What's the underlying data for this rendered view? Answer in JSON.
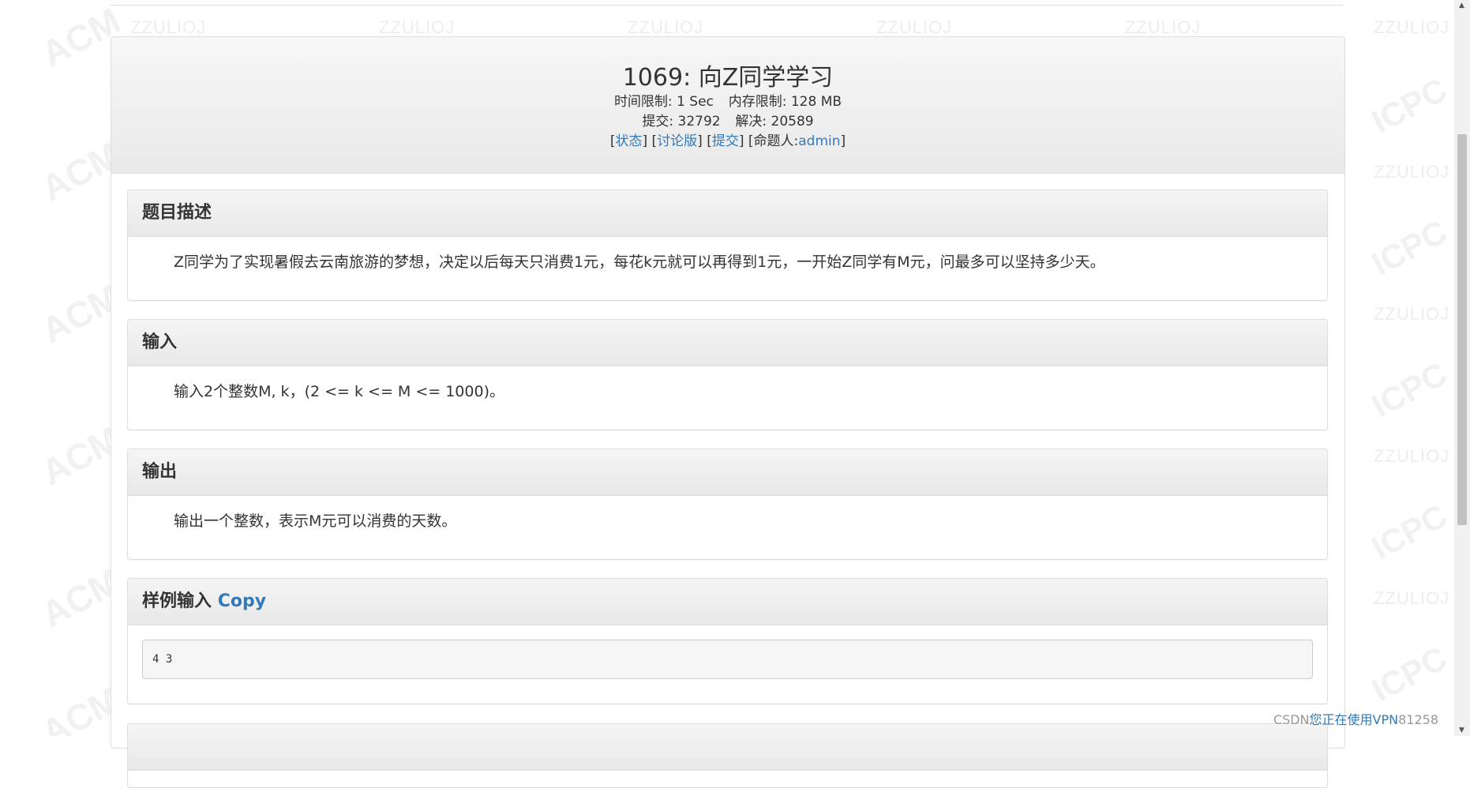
{
  "problem": {
    "title": "1069: 向Z同学学习",
    "time_limit_label": "时间限制:",
    "time_limit": "1 Sec",
    "memory_limit_label": "内存限制:",
    "memory_limit": "128 MB",
    "submit_label": "提交:",
    "submit_count": "32792",
    "solved_label": "解决:",
    "solved_count": "20589",
    "links": {
      "status": "状态",
      "discuss": "讨论版",
      "submit": "提交",
      "setter_label": "命题人:",
      "setter": "admin"
    }
  },
  "sections": {
    "description": {
      "title": "题目描述",
      "text": "Z同学为了实现暑假去云南旅游的梦想，决定以后每天只消费1元，每花k元就可以再得到1元，一开始Z同学有M元，问最多可以坚持多少天。"
    },
    "input": {
      "title": "输入",
      "text": "输入2个整数M, k，(2 <= k <= M <= 1000)。"
    },
    "output": {
      "title": "输出",
      "text": "输出一个整数，表示M元可以消费的天数。"
    },
    "sample_input": {
      "title": "样例输入",
      "copy_label": "Copy",
      "value": "4 3"
    }
  },
  "watermarks": {
    "left": "ACM",
    "right": "ICPC",
    "site": "ZZULIOJ"
  },
  "footer": {
    "vpn_text": "您正在使用VPN",
    "csdn_prefix": "CSDN",
    "csdn_suffix": "81258"
  },
  "colors": {
    "link": "#337ab7",
    "panel_border": "#dddddd",
    "header_bg": "#eeeeee"
  }
}
